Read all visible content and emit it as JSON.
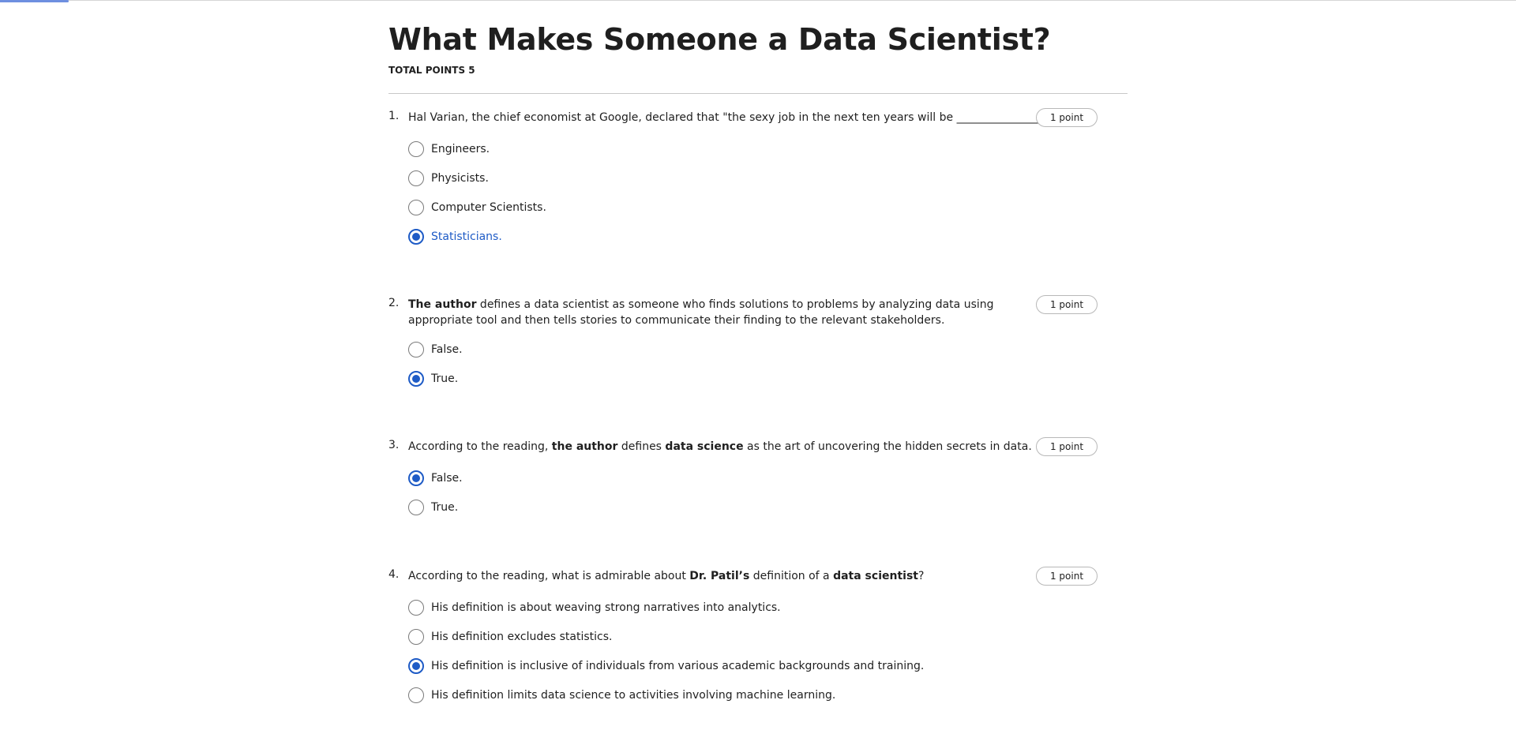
{
  "quiz": {
    "title": "What Makes Someone a Data Scientist?",
    "total_points": "TOTAL POINTS 5"
  },
  "colors": {
    "accent": "#1e5bc6",
    "progress": "#6e8fe0"
  },
  "questions": [
    {
      "number": "1.",
      "text_a": "Hal Varian, the chief economist at Google, declared that \"the sexy job in the next ten years will be ________________\".",
      "points": "1 point",
      "options": [
        "Engineers.",
        "Physicists.",
        "Computer Scientists.",
        "Statisticians."
      ],
      "selected": 3
    },
    {
      "number": "2.",
      "bold_a": "The author",
      "text_a": " defines a data scientist as someone who finds solutions to problems by analyzing data using appropriate tool and then tells stories to communicate their finding to the relevant stakeholders.",
      "points": "1 point",
      "options": [
        "False.",
        "True."
      ],
      "selected": 1
    },
    {
      "number": "3.",
      "text_a": "According to the reading, ",
      "bold_a": "the author",
      "text_b": " defines ",
      "bold_b": "data science",
      "text_c": " as the art of uncovering the hidden secrets in data.",
      "points": "1 point",
      "options": [
        "False.",
        "True."
      ],
      "selected": 0
    },
    {
      "number": "4.",
      "text_a": "According to the reading, what is admirable about ",
      "bold_a": "Dr. Patil’s",
      "text_b": " definition of a ",
      "bold_b": "data scientist",
      "text_c": "?",
      "points": "1 point",
      "options": [
        "His definition is about weaving strong narratives into analytics.",
        "His definition excludes statistics.",
        "His definition is inclusive of individuals from various academic backgrounds and training.",
        "His definition limits data science to activities involving machine learning."
      ],
      "selected": 2
    }
  ]
}
